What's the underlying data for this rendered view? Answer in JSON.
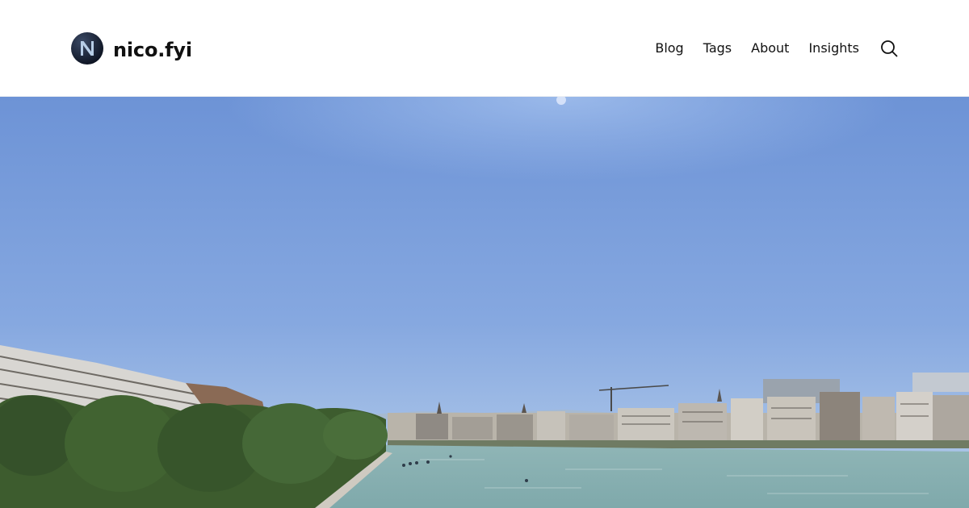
{
  "site": {
    "brand_name": "nico.fyi",
    "logo_icon": "n-monogram-icon"
  },
  "nav": {
    "items": [
      {
        "label": "Blog"
      },
      {
        "label": "Tags"
      },
      {
        "label": "About"
      },
      {
        "label": "Insights"
      }
    ],
    "search_icon": "search-icon"
  },
  "hero": {
    "image_subject": "river-city-photo",
    "colors": {
      "sky_top": "#6f96d9",
      "sky_bottom": "#a9c4e6",
      "river": "#8fb7b8",
      "trees": "#3a5a2c"
    }
  }
}
